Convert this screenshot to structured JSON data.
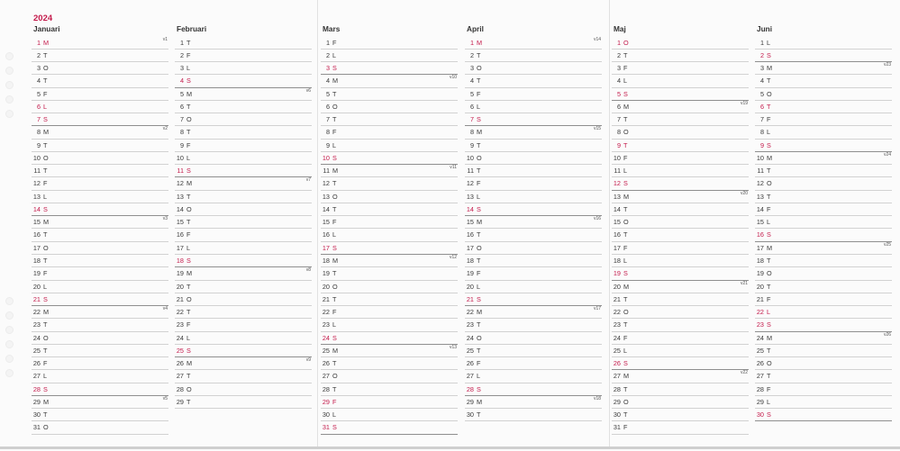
{
  "year": "2024",
  "colors": {
    "holiday": "#c41a4b",
    "text": "#3a3a3a",
    "year": "#c41a4b"
  },
  "months": [
    {
      "name": "Januari",
      "days": [
        {
          "d": "1",
          "w": "M",
          "holiday": true,
          "week": "v1"
        },
        {
          "d": "2",
          "w": "T"
        },
        {
          "d": "3",
          "w": "O"
        },
        {
          "d": "4",
          "w": "T"
        },
        {
          "d": "5",
          "w": "F"
        },
        {
          "d": "6",
          "w": "L",
          "holiday": true
        },
        {
          "d": "7",
          "w": "S",
          "holiday": true
        },
        {
          "d": "8",
          "w": "M",
          "week": "v2"
        },
        {
          "d": "9",
          "w": "T"
        },
        {
          "d": "10",
          "w": "O"
        },
        {
          "d": "11",
          "w": "T"
        },
        {
          "d": "12",
          "w": "F"
        },
        {
          "d": "13",
          "w": "L"
        },
        {
          "d": "14",
          "w": "S",
          "holiday": true
        },
        {
          "d": "15",
          "w": "M",
          "week": "v3"
        },
        {
          "d": "16",
          "w": "T"
        },
        {
          "d": "17",
          "w": "O"
        },
        {
          "d": "18",
          "w": "T"
        },
        {
          "d": "19",
          "w": "F"
        },
        {
          "d": "20",
          "w": "L"
        },
        {
          "d": "21",
          "w": "S",
          "holiday": true
        },
        {
          "d": "22",
          "w": "M",
          "week": "v4"
        },
        {
          "d": "23",
          "w": "T"
        },
        {
          "d": "24",
          "w": "O"
        },
        {
          "d": "25",
          "w": "T"
        },
        {
          "d": "26",
          "w": "F"
        },
        {
          "d": "27",
          "w": "L"
        },
        {
          "d": "28",
          "w": "S",
          "holiday": true
        },
        {
          "d": "29",
          "w": "M",
          "week": "v5"
        },
        {
          "d": "30",
          "w": "T"
        },
        {
          "d": "31",
          "w": "O"
        }
      ]
    },
    {
      "name": "Februari",
      "days": [
        {
          "d": "1",
          "w": "T"
        },
        {
          "d": "2",
          "w": "F"
        },
        {
          "d": "3",
          "w": "L"
        },
        {
          "d": "4",
          "w": "S",
          "holiday": true
        },
        {
          "d": "5",
          "w": "M",
          "week": "v6"
        },
        {
          "d": "6",
          "w": "T"
        },
        {
          "d": "7",
          "w": "O"
        },
        {
          "d": "8",
          "w": "T"
        },
        {
          "d": "9",
          "w": "F"
        },
        {
          "d": "10",
          "w": "L"
        },
        {
          "d": "11",
          "w": "S",
          "holiday": true
        },
        {
          "d": "12",
          "w": "M",
          "week": "v7"
        },
        {
          "d": "13",
          "w": "T"
        },
        {
          "d": "14",
          "w": "O"
        },
        {
          "d": "15",
          "w": "T"
        },
        {
          "d": "16",
          "w": "F"
        },
        {
          "d": "17",
          "w": "L"
        },
        {
          "d": "18",
          "w": "S",
          "holiday": true
        },
        {
          "d": "19",
          "w": "M",
          "week": "v8"
        },
        {
          "d": "20",
          "w": "T"
        },
        {
          "d": "21",
          "w": "O"
        },
        {
          "d": "22",
          "w": "T"
        },
        {
          "d": "23",
          "w": "F"
        },
        {
          "d": "24",
          "w": "L"
        },
        {
          "d": "25",
          "w": "S",
          "holiday": true
        },
        {
          "d": "26",
          "w": "M",
          "week": "v9"
        },
        {
          "d": "27",
          "w": "T"
        },
        {
          "d": "28",
          "w": "O"
        },
        {
          "d": "29",
          "w": "T"
        }
      ]
    },
    {
      "name": "Mars",
      "days": [
        {
          "d": "1",
          "w": "F"
        },
        {
          "d": "2",
          "w": "L"
        },
        {
          "d": "3",
          "w": "S",
          "holiday": true
        },
        {
          "d": "4",
          "w": "M",
          "week": "v10"
        },
        {
          "d": "5",
          "w": "T"
        },
        {
          "d": "6",
          "w": "O"
        },
        {
          "d": "7",
          "w": "T"
        },
        {
          "d": "8",
          "w": "F"
        },
        {
          "d": "9",
          "w": "L"
        },
        {
          "d": "10",
          "w": "S",
          "holiday": true
        },
        {
          "d": "11",
          "w": "M",
          "week": "v11"
        },
        {
          "d": "12",
          "w": "T"
        },
        {
          "d": "13",
          "w": "O"
        },
        {
          "d": "14",
          "w": "T"
        },
        {
          "d": "15",
          "w": "F"
        },
        {
          "d": "16",
          "w": "L"
        },
        {
          "d": "17",
          "w": "S",
          "holiday": true
        },
        {
          "d": "18",
          "w": "M",
          "week": "v12"
        },
        {
          "d": "19",
          "w": "T"
        },
        {
          "d": "20",
          "w": "O"
        },
        {
          "d": "21",
          "w": "T"
        },
        {
          "d": "22",
          "w": "F"
        },
        {
          "d": "23",
          "w": "L"
        },
        {
          "d": "24",
          "w": "S",
          "holiday": true
        },
        {
          "d": "25",
          "w": "M",
          "week": "v13"
        },
        {
          "d": "26",
          "w": "T"
        },
        {
          "d": "27",
          "w": "O"
        },
        {
          "d": "28",
          "w": "T"
        },
        {
          "d": "29",
          "w": "F",
          "holiday": true
        },
        {
          "d": "30",
          "w": "L"
        },
        {
          "d": "31",
          "w": "S",
          "holiday": true
        }
      ]
    },
    {
      "name": "April",
      "days": [
        {
          "d": "1",
          "w": "M",
          "holiday": true,
          "week": "v14"
        },
        {
          "d": "2",
          "w": "T"
        },
        {
          "d": "3",
          "w": "O"
        },
        {
          "d": "4",
          "w": "T"
        },
        {
          "d": "5",
          "w": "F"
        },
        {
          "d": "6",
          "w": "L"
        },
        {
          "d": "7",
          "w": "S",
          "holiday": true
        },
        {
          "d": "8",
          "w": "M",
          "week": "v15"
        },
        {
          "d": "9",
          "w": "T"
        },
        {
          "d": "10",
          "w": "O"
        },
        {
          "d": "11",
          "w": "T"
        },
        {
          "d": "12",
          "w": "F"
        },
        {
          "d": "13",
          "w": "L"
        },
        {
          "d": "14",
          "w": "S",
          "holiday": true
        },
        {
          "d": "15",
          "w": "M",
          "week": "v16"
        },
        {
          "d": "16",
          "w": "T"
        },
        {
          "d": "17",
          "w": "O"
        },
        {
          "d": "18",
          "w": "T"
        },
        {
          "d": "19",
          "w": "F"
        },
        {
          "d": "20",
          "w": "L"
        },
        {
          "d": "21",
          "w": "S",
          "holiday": true
        },
        {
          "d": "22",
          "w": "M",
          "week": "v17"
        },
        {
          "d": "23",
          "w": "T"
        },
        {
          "d": "24",
          "w": "O"
        },
        {
          "d": "25",
          "w": "T"
        },
        {
          "d": "26",
          "w": "F"
        },
        {
          "d": "27",
          "w": "L"
        },
        {
          "d": "28",
          "w": "S",
          "holiday": true
        },
        {
          "d": "29",
          "w": "M",
          "week": "v18"
        },
        {
          "d": "30",
          "w": "T"
        }
      ]
    },
    {
      "name": "Maj",
      "days": [
        {
          "d": "1",
          "w": "O",
          "holiday": true
        },
        {
          "d": "2",
          "w": "T"
        },
        {
          "d": "3",
          "w": "F"
        },
        {
          "d": "4",
          "w": "L"
        },
        {
          "d": "5",
          "w": "S",
          "holiday": true
        },
        {
          "d": "6",
          "w": "M",
          "week": "v19"
        },
        {
          "d": "7",
          "w": "T"
        },
        {
          "d": "8",
          "w": "O"
        },
        {
          "d": "9",
          "w": "T",
          "holiday": true
        },
        {
          "d": "10",
          "w": "F"
        },
        {
          "d": "11",
          "w": "L"
        },
        {
          "d": "12",
          "w": "S",
          "holiday": true
        },
        {
          "d": "13",
          "w": "M",
          "week": "v20"
        },
        {
          "d": "14",
          "w": "T"
        },
        {
          "d": "15",
          "w": "O"
        },
        {
          "d": "16",
          "w": "T"
        },
        {
          "d": "17",
          "w": "F"
        },
        {
          "d": "18",
          "w": "L"
        },
        {
          "d": "19",
          "w": "S",
          "holiday": true
        },
        {
          "d": "20",
          "w": "M",
          "week": "v21"
        },
        {
          "d": "21",
          "w": "T"
        },
        {
          "d": "22",
          "w": "O"
        },
        {
          "d": "23",
          "w": "T"
        },
        {
          "d": "24",
          "w": "F"
        },
        {
          "d": "25",
          "w": "L"
        },
        {
          "d": "26",
          "w": "S",
          "holiday": true
        },
        {
          "d": "27",
          "w": "M",
          "week": "v22"
        },
        {
          "d": "28",
          "w": "T"
        },
        {
          "d": "29",
          "w": "O"
        },
        {
          "d": "30",
          "w": "T"
        },
        {
          "d": "31",
          "w": "F"
        }
      ]
    },
    {
      "name": "Juni",
      "days": [
        {
          "d": "1",
          "w": "L"
        },
        {
          "d": "2",
          "w": "S",
          "holiday": true
        },
        {
          "d": "3",
          "w": "M",
          "week": "v23"
        },
        {
          "d": "4",
          "w": "T"
        },
        {
          "d": "5",
          "w": "O"
        },
        {
          "d": "6",
          "w": "T",
          "holiday": true
        },
        {
          "d": "7",
          "w": "F"
        },
        {
          "d": "8",
          "w": "L"
        },
        {
          "d": "9",
          "w": "S",
          "holiday": true
        },
        {
          "d": "10",
          "w": "M",
          "week": "v24"
        },
        {
          "d": "11",
          "w": "T"
        },
        {
          "d": "12",
          "w": "O"
        },
        {
          "d": "13",
          "w": "T"
        },
        {
          "d": "14",
          "w": "F"
        },
        {
          "d": "15",
          "w": "L"
        },
        {
          "d": "16",
          "w": "S",
          "holiday": true
        },
        {
          "d": "17",
          "w": "M",
          "week": "v25"
        },
        {
          "d": "18",
          "w": "T"
        },
        {
          "d": "19",
          "w": "O"
        },
        {
          "d": "20",
          "w": "T"
        },
        {
          "d": "21",
          "w": "F"
        },
        {
          "d": "22",
          "w": "L",
          "holiday": true
        },
        {
          "d": "23",
          "w": "S",
          "holiday": true
        },
        {
          "d": "24",
          "w": "M",
          "week": "v26"
        },
        {
          "d": "25",
          "w": "T"
        },
        {
          "d": "26",
          "w": "O"
        },
        {
          "d": "27",
          "w": "T"
        },
        {
          "d": "28",
          "w": "F"
        },
        {
          "d": "29",
          "w": "L"
        },
        {
          "d": "30",
          "w": "S",
          "holiday": true
        }
      ]
    }
  ]
}
